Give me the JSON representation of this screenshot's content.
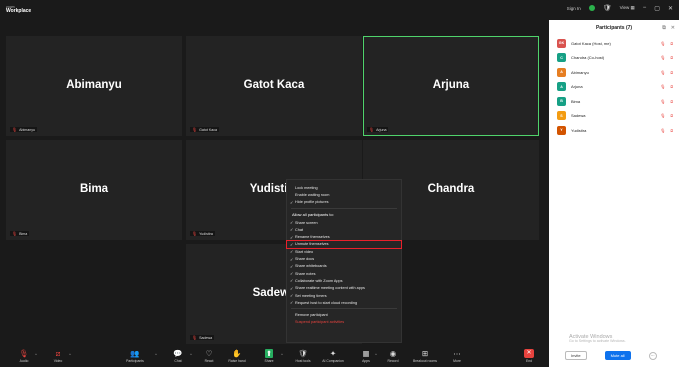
{
  "titlebar": {
    "brand_top": "zoom",
    "brand_main": "Workplace",
    "signin": "Sign In",
    "view": "View ▦"
  },
  "participants": [
    {
      "name": "Abimanyu",
      "tag": "Abimanyu"
    },
    {
      "name": "Gatot Kaca",
      "tag": "Gatot Kaca"
    },
    {
      "name": "Arjuna",
      "tag": "Arjuna"
    },
    {
      "name": "Bima",
      "tag": "Bima"
    },
    {
      "name": "Yudistira",
      "tag": "Yudistira"
    },
    {
      "name": "Chandra",
      "tag": "Chandra"
    },
    {
      "name": "Sadewa",
      "tag": "Sadewa"
    }
  ],
  "menu": {
    "items_top": [
      "Lock meeting",
      "Enable waiting room",
      "Hide profile pictures"
    ],
    "section": "Allow all participants to:",
    "allow_items": [
      "Share screen",
      "Chat",
      "Rename themselves",
      "Unmute themselves",
      "Start video",
      "Share docs",
      "Share whiteboards",
      "Share notes",
      "Collaborate with Zoom Apps",
      "Share realtime meeting content with apps",
      "Set meeting timers",
      "Request host to start cloud recording"
    ],
    "remove": "Remove participant",
    "suspend": "Suspend participant activities"
  },
  "panel": {
    "title": "Participants (7)",
    "rows": [
      {
        "initials": "GK",
        "name": "Gatot Kaca (Host, me)",
        "color": "#d9534f"
      },
      {
        "initials": "C",
        "name": "Chandra (Co-host)",
        "color": "#16a085"
      },
      {
        "initials": "A",
        "name": "Abimanyu",
        "color": "#e67e22"
      },
      {
        "initials": "A",
        "name": "Arjuna",
        "color": "#16a085"
      },
      {
        "initials": "B",
        "name": "Bima",
        "color": "#16a085"
      },
      {
        "initials": "S",
        "name": "Sadewa",
        "color": "#f39c12"
      },
      {
        "initials": "Y",
        "name": "Yudistira",
        "color": "#d35400"
      }
    ],
    "activate_title": "Activate Windows",
    "activate_sub": "Go to Settings to activate Windows.",
    "invite": "Invite",
    "mute_all": "Mute all"
  },
  "toolbar": {
    "audio": "Audio",
    "video": "Video",
    "participants": "Participants",
    "chat": "Chat",
    "react": "React",
    "raise": "Raise hand",
    "share": "Share",
    "host_tools": "Host tools",
    "companion": "AI Companion",
    "apps": "Apps",
    "record": "Record",
    "breakout": "Breakout rooms",
    "more": "More",
    "end": "End",
    "participant_count": "7"
  }
}
